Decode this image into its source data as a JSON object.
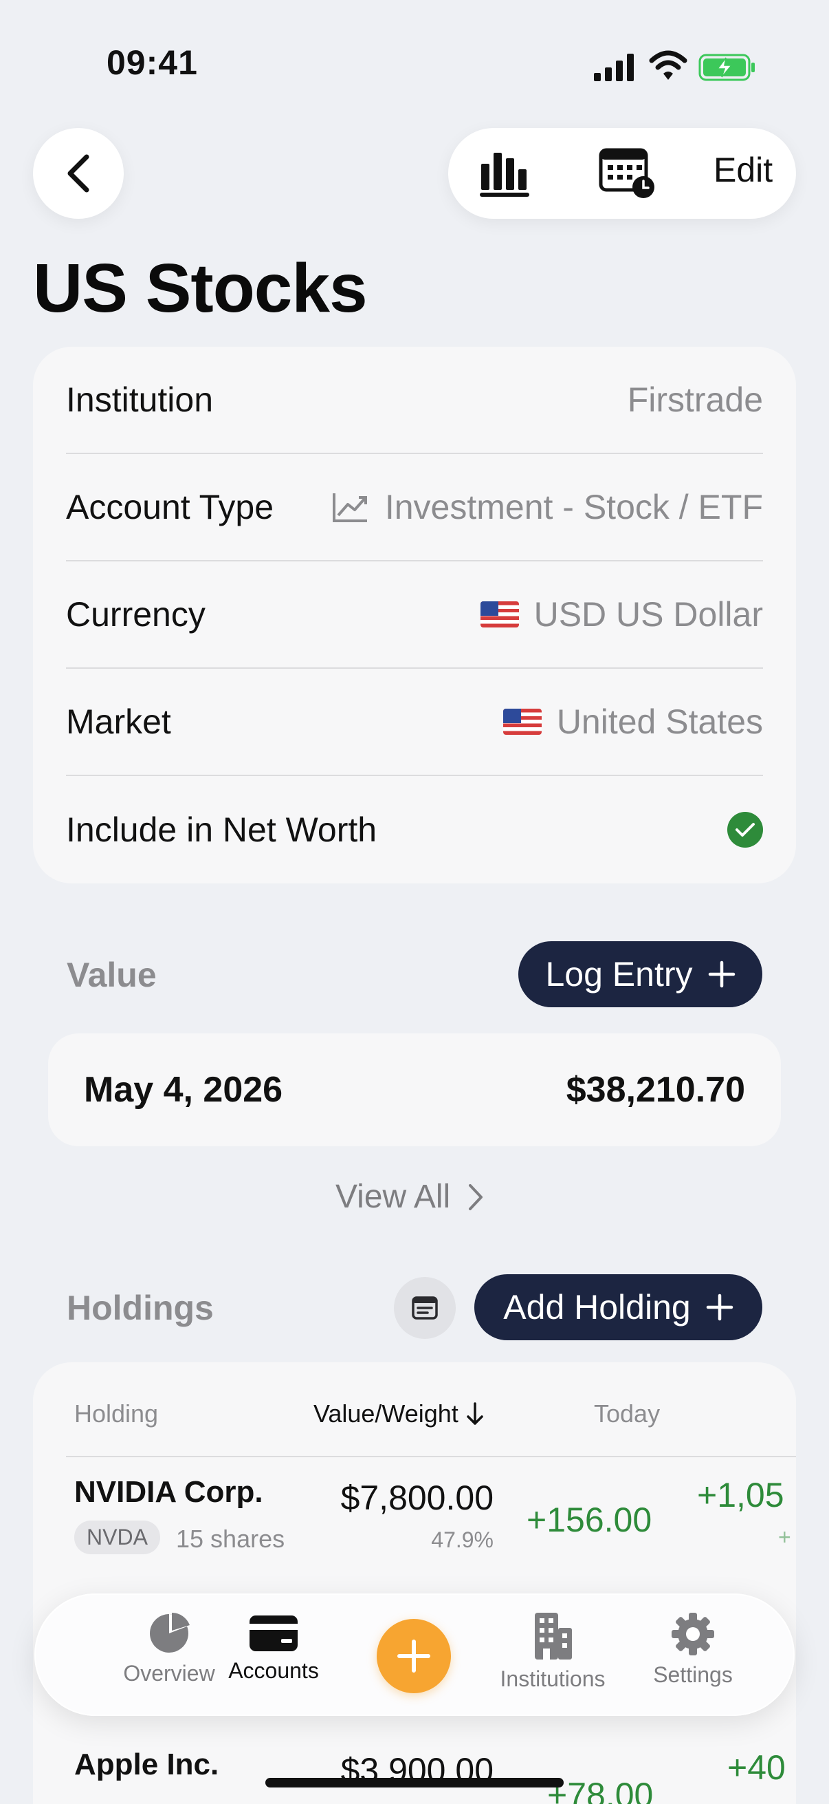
{
  "status_bar": {
    "time": "09:41"
  },
  "header": {
    "edit_label": "Edit",
    "title": "US Stocks"
  },
  "details": {
    "institution": {
      "label": "Institution",
      "value": "Firstrade"
    },
    "account_type": {
      "label": "Account Type",
      "value": "Investment - Stock / ETF",
      "icon": "trend-chart-icon"
    },
    "currency": {
      "label": "Currency",
      "value": "USD US Dollar",
      "icon": "us-flag-icon"
    },
    "market": {
      "label": "Market",
      "value": "United States",
      "icon": "us-flag-icon"
    },
    "net_worth": {
      "label": "Include in Net Worth",
      "checked": true
    }
  },
  "value_section": {
    "heading": "Value",
    "log_entry_label": "Log Entry",
    "entry": {
      "date": "May 4, 2026",
      "amount": "$38,210.70"
    },
    "view_all_label": "View All"
  },
  "holdings_section": {
    "heading": "Holdings",
    "add_holding_label": "Add Holding",
    "columns": {
      "holding": "Holding",
      "value_weight": "Value/Weight",
      "today": "Today"
    },
    "rows": [
      {
        "name": "NVIDIA Corp.",
        "ticker": "NVDA",
        "shares": "15 shares",
        "value": "$7,800.00",
        "weight": "47.9%",
        "today": "+156.00",
        "total": "+1,05",
        "total_sub": "+"
      },
      {
        "name": "Apple Inc.",
        "value": "$3,900.00",
        "today": "+78.00",
        "total": "+40"
      }
    ]
  },
  "tab_bar": {
    "tabs": [
      {
        "label": "Overview",
        "icon": "pie-chart-icon"
      },
      {
        "label": "Accounts",
        "icon": "card-icon",
        "active": true
      },
      {
        "label": "Institutions",
        "icon": "building-icon"
      },
      {
        "label": "Settings",
        "icon": "gear-icon"
      }
    ]
  },
  "colors": {
    "primary_dark": "#1c2541",
    "positive": "#2e8b3a",
    "accent": "#f7a531",
    "background": "#eef0f4"
  }
}
